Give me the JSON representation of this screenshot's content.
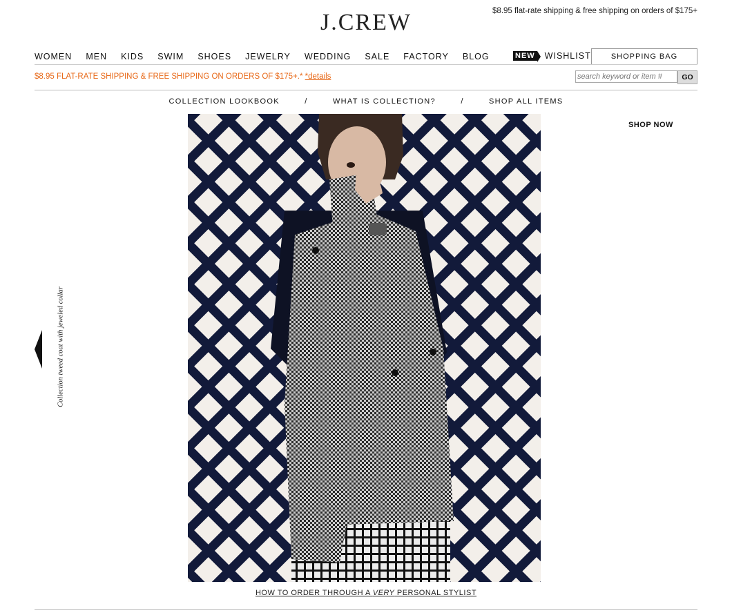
{
  "brand": {
    "logo": "J.CREW"
  },
  "header": {
    "top_promo": "$8.95 flat-rate shipping & free shipping on orders of $175+",
    "nav": [
      "WOMEN",
      "MEN",
      "KIDS",
      "SWIM",
      "SHOES",
      "JEWELRY",
      "WEDDING",
      "SALE",
      "FACTORY",
      "BLOG"
    ],
    "new_badge": "NEW",
    "wishlist": "WISHLIST",
    "bag": "SHOPPING BAG",
    "ship_promo": "$8.95 FLAT-RATE SHIPPING & FREE SHIPPING ON ORDERS OF $175+.*",
    "details": "*details",
    "search_placeholder": "search keyword or item #",
    "go": "GO"
  },
  "subnav": {
    "items": [
      "COLLECTION LOOKBOOK",
      "WHAT IS COLLECTION?",
      "SHOP ALL ITEMS"
    ],
    "separator": "/"
  },
  "main": {
    "shop_now": "SHOP NOW",
    "caption": "Collection tweed coat with jeweled collar",
    "stylist_pre": "HOW TO ORDER THROUGH A ",
    "stylist_em": "VERY",
    "stylist_post": " PERSONAL STYLIST"
  },
  "colors": {
    "accent": "#e86a1a",
    "navy": "#121a3a"
  }
}
